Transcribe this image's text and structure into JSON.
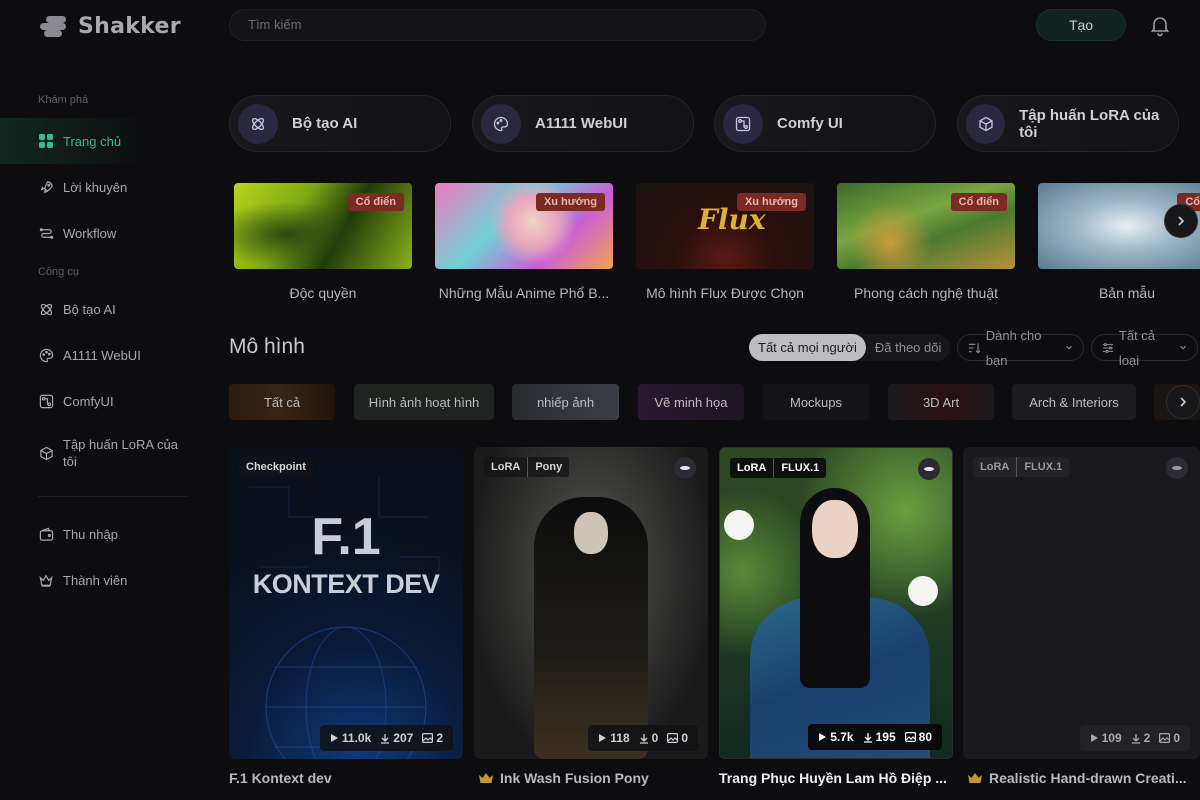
{
  "brand": {
    "name": "Shakker"
  },
  "header": {
    "search_placeholder": "Tìm kiếm",
    "create_label": "Tạo"
  },
  "sidebar": {
    "section_explore": "Khám phá",
    "explore_items": [
      {
        "label": "Trang chủ",
        "icon": "grid-icon"
      },
      {
        "label": "Lời khuyên",
        "icon": "rocket-icon"
      },
      {
        "label": "Workflow",
        "icon": "workflow-icon"
      }
    ],
    "section_tools": "Công cụ",
    "tool_items": [
      {
        "label": "Bộ tạo AI",
        "icon": "ai-generator-icon"
      },
      {
        "label": "A1111 WebUI",
        "icon": "palette-icon"
      },
      {
        "label": "ComfyUI",
        "icon": "comfy-icon"
      },
      {
        "label": "Tập huấn LoRA của tôi",
        "icon": "cube-icon"
      }
    ],
    "account_items": [
      {
        "label": "Thu nhập",
        "icon": "wallet-icon"
      },
      {
        "label": "Thành viên",
        "icon": "crown-icon"
      }
    ]
  },
  "tools": [
    {
      "label": "Bộ tạo AI",
      "icon": "ai-generator-icon"
    },
    {
      "label": "A1111 WebUI",
      "icon": "palette-icon"
    },
    {
      "label": "Comfy UI",
      "icon": "comfy-icon"
    },
    {
      "label": "Tập huấn LoRA của tôi",
      "icon": "cube-icon"
    }
  ],
  "featured": [
    {
      "caption": "Độc quyền",
      "badge": "Cổ điển"
    },
    {
      "caption": "Những Mẫu Anime Phổ B...",
      "badge": "Xu hướng"
    },
    {
      "caption": "Mô hình Flux Được Chọn",
      "badge": "Xu hướng",
      "art_text": "Flux"
    },
    {
      "caption": "Phong cách nghệ thuật",
      "badge": "Cổ điển"
    },
    {
      "caption": "Bản mẫu",
      "badge": "Cổ"
    }
  ],
  "models_section": {
    "title": "Mô hình",
    "audience_tabs": [
      "Tất cả mọi người",
      "Đã theo dõi"
    ],
    "sort_label": "Dành cho bạn",
    "type_label": "Tất cả loại",
    "categories": [
      "Tất cả",
      "Hình ảnh hoạt hình",
      "nhiếp ảnh",
      "Vẽ minh họa",
      "Mockups",
      "3D Art",
      "Arch & Interiors"
    ]
  },
  "models": [
    {
      "tags": [
        "Checkpoint"
      ],
      "cover_line1": "F.1",
      "cover_line2": "KONTEXT DEV",
      "runs": "11.0k",
      "downloads": "207",
      "images": "2",
      "name": "F.1 Kontext dev",
      "crown": false
    },
    {
      "tags": [
        "LoRA",
        "Pony"
      ],
      "runs": "118",
      "downloads": "0",
      "images": "0",
      "name": "Ink Wash Fusion Pony",
      "crown": true
    },
    {
      "tags": [
        "LoRA",
        "FLUX.1"
      ],
      "runs": "5.7k",
      "downloads": "195",
      "images": "80",
      "name": "Trang Phục Huyền Lam Hồ Điệp ...",
      "crown": false
    },
    {
      "tags": [
        "LoRA",
        "FLUX.1"
      ],
      "runs": "109",
      "downloads": "2",
      "images": "0",
      "name": "Realistic Hand-drawn Creati...",
      "crown": true
    }
  ],
  "colors": {
    "accent": "#2fbf87",
    "background": "#0d0d0f",
    "badge": "#7a2a22"
  }
}
